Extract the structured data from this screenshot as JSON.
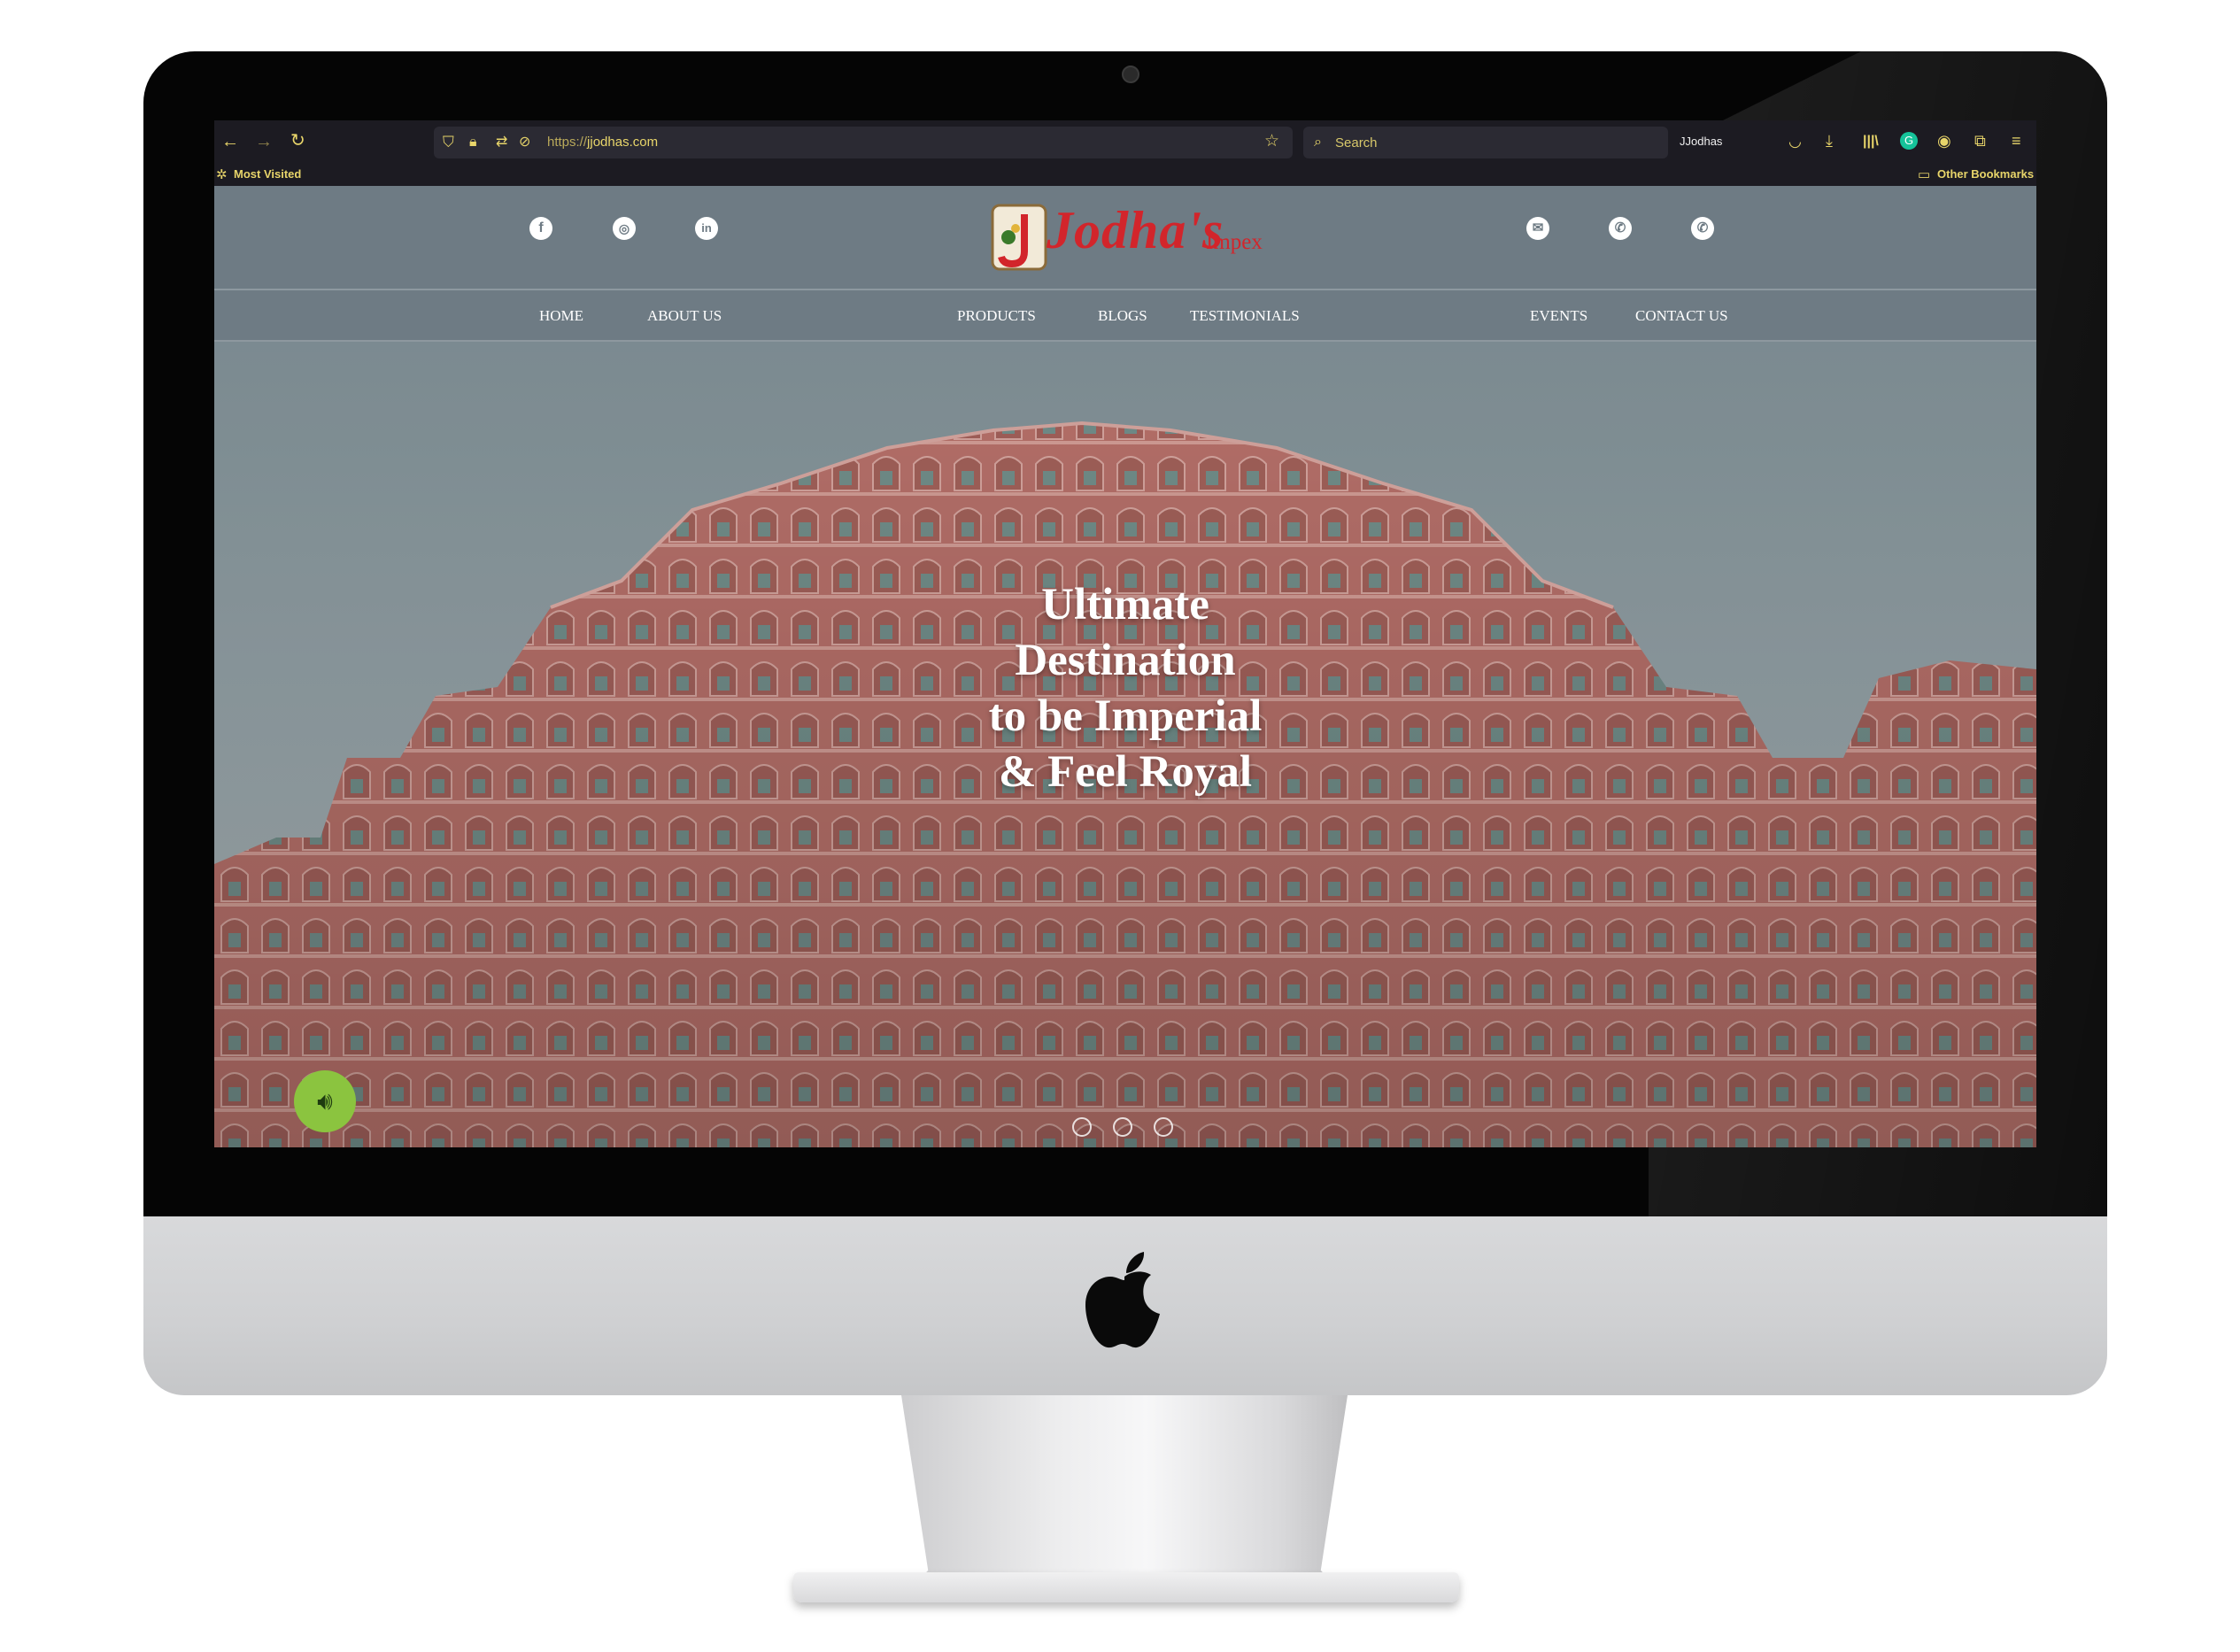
{
  "browser": {
    "url": "https://jjodhas.com",
    "url_scheme": "https://",
    "url_host": "jjodhas.com",
    "search_placeholder": "Search",
    "profile_name": "JJodhas",
    "bookmarks": {
      "most_visited": "Most Visited",
      "other_bookmarks": "Other Bookmarks"
    }
  },
  "site": {
    "logo": {
      "main": "Jodha's",
      "sub": "Impex"
    },
    "social_left": [
      "facebook-icon",
      "instagram-icon",
      "linkedin-icon"
    ],
    "social_right": [
      "email-icon",
      "phone-icon",
      "whatsapp-icon"
    ],
    "nav": {
      "home": "HOME",
      "about": "ABOUT US",
      "products": "PRODUCTS",
      "blogs": "BLOGS",
      "testimonials": "TESTIMONIALS",
      "events": "EVENTS",
      "contact": "CONTACT US"
    },
    "hero": {
      "line1": "Ultimate",
      "line2": "Destination",
      "line3": "to be Imperial",
      "line4": "& Feel Royal"
    }
  },
  "colors": {
    "header_bg": "#6e7b84",
    "logo_red": "#d2252b",
    "sound_button": "#8bc43f",
    "browser_accent": "#e8d56a"
  }
}
